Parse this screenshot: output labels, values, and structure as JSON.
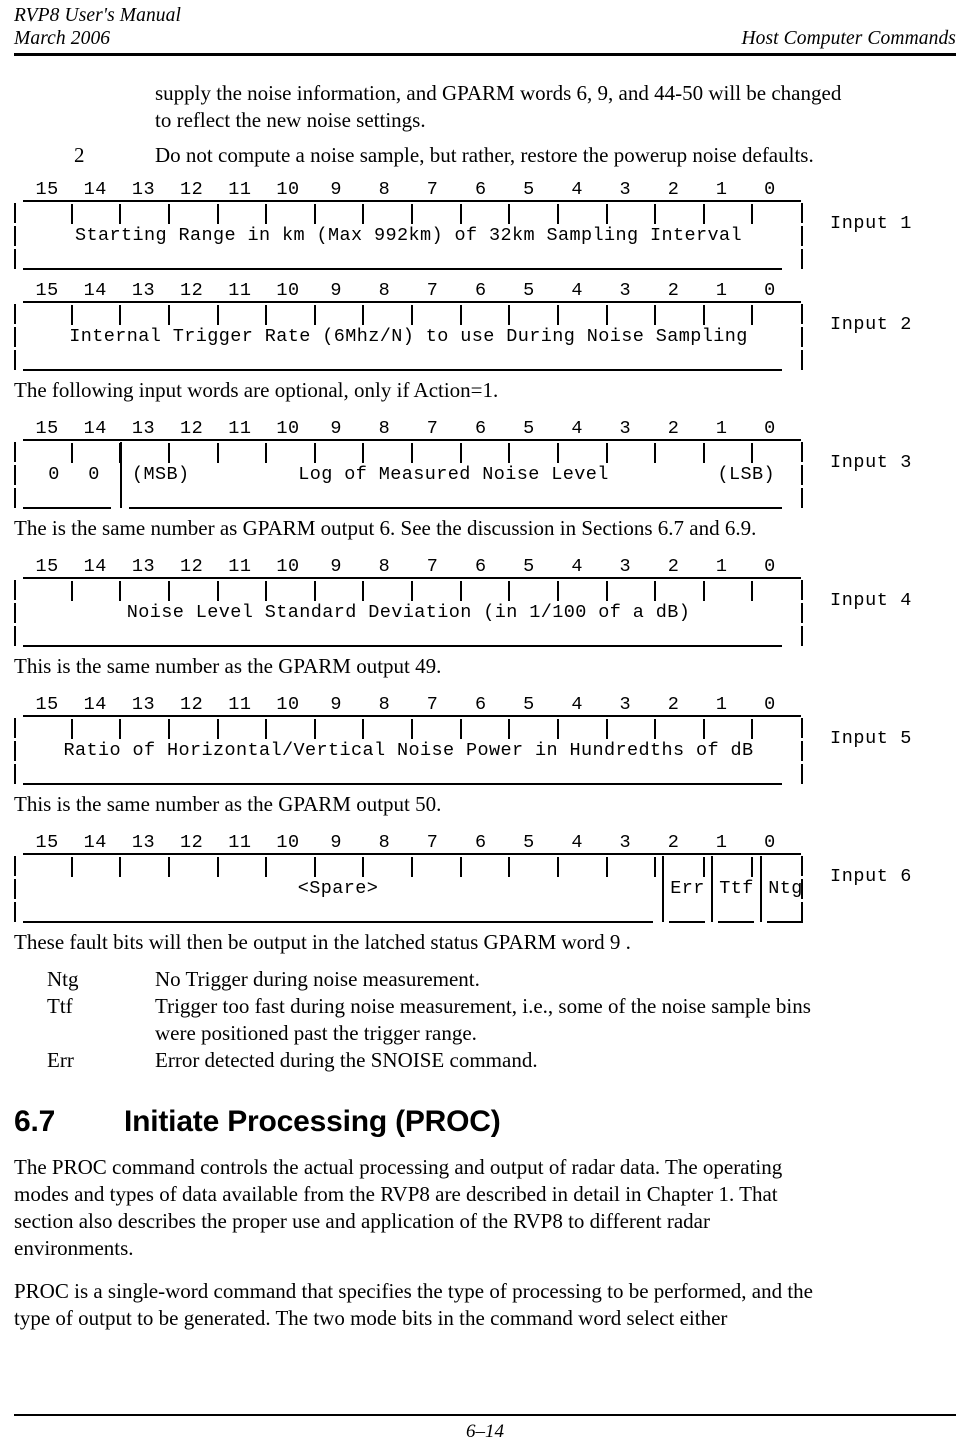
{
  "header": {
    "left_line1": "RVP8 User's Manual",
    "left_line2": "March 2006",
    "right": "Host Computer Commands"
  },
  "content": {
    "continued_paragraph_line1": "supply the noise information, and GPARM words 6, 9, and 44-50 will be changed",
    "continued_paragraph_line2": "to reflect the new noise settings.",
    "list_item_2": {
      "key": "2",
      "text": "Do not compute a noise sample, but rather, restore the powerup noise defaults."
    },
    "note_optional": "The following input words are optional, only if Action=1.",
    "note_gparm6": "The is the same number as GPARM output 6.  See the discussion in Sections 6.7 and 6.9.",
    "note_gparm49": "This is the same number as the GPARM output 49.",
    "note_gparm50": "This is the same number as the GPARM output 50.",
    "note_faultbits": "These fault bits will then be output in the latched status GPARM word 9 ."
  },
  "bit_numbers": [
    "15",
    "14",
    "13",
    "12",
    "11",
    "10",
    "9",
    "8",
    "7",
    "6",
    "5",
    "4",
    "3",
    "2",
    "1",
    "0"
  ],
  "diagrams": [
    {
      "id": "input-1",
      "side_label": "Input 1",
      "label": "Starting Range in km (Max 992km) of 32km Sampling Interval"
    },
    {
      "id": "input-2",
      "side_label": "Input 2",
      "label": "Internal Trigger Rate (6Mhz/N) to use During Noise Sampling"
    },
    {
      "id": "input-3",
      "side_label": "Input 3",
      "label_left_bit15": "0",
      "label_left_bit14": "0",
      "label_msb": "(MSB)",
      "label_main": "Log of Measured Noise Level",
      "label_lsb": "(LSB)"
    },
    {
      "id": "input-4",
      "side_label": "Input 4",
      "label": "Noise Level Standard Deviation (in 1/100 of a dB)"
    },
    {
      "id": "input-5",
      "side_label": "Input 5",
      "label": "Ratio of Horizontal/Vertical Noise Power in Hundredths of dB"
    },
    {
      "id": "input-6",
      "side_label": "Input 6",
      "label_spare": "<Spare>",
      "bit2": "Err",
      "bit1": "Ttf",
      "bit0": "Ntg"
    }
  ],
  "fault_bits": [
    {
      "term": "Ntg",
      "desc": "No Trigger during noise measurement."
    },
    {
      "term": "Ttf",
      "desc_line1": "Trigger too fast during noise measurement, i.e., some of the noise sample bins",
      "desc_line2": "were positioned past the trigger range."
    },
    {
      "term": "Err",
      "desc": "Error detected during the SNOISE command."
    }
  ],
  "section": {
    "number": "6.7",
    "title": "Initiate Processing (PROC)",
    "para1_line1": "The PROC command controls the actual processing and output of radar data.  The operating",
    "para1_line2": "modes and types of data available from the RVP8 are described in detail in Chapter 1.  That",
    "para1_line3": "section also describes the proper use and application of the RVP8 to different radar",
    "para1_line4": "environments.",
    "para2_line1": "PROC is a single-word command that specifies the type of processing to be performed, and the",
    "para2_line2": "type of output to be generated.  The two mode bits in the command word select either"
  },
  "footer": {
    "page_number": "6–14"
  }
}
